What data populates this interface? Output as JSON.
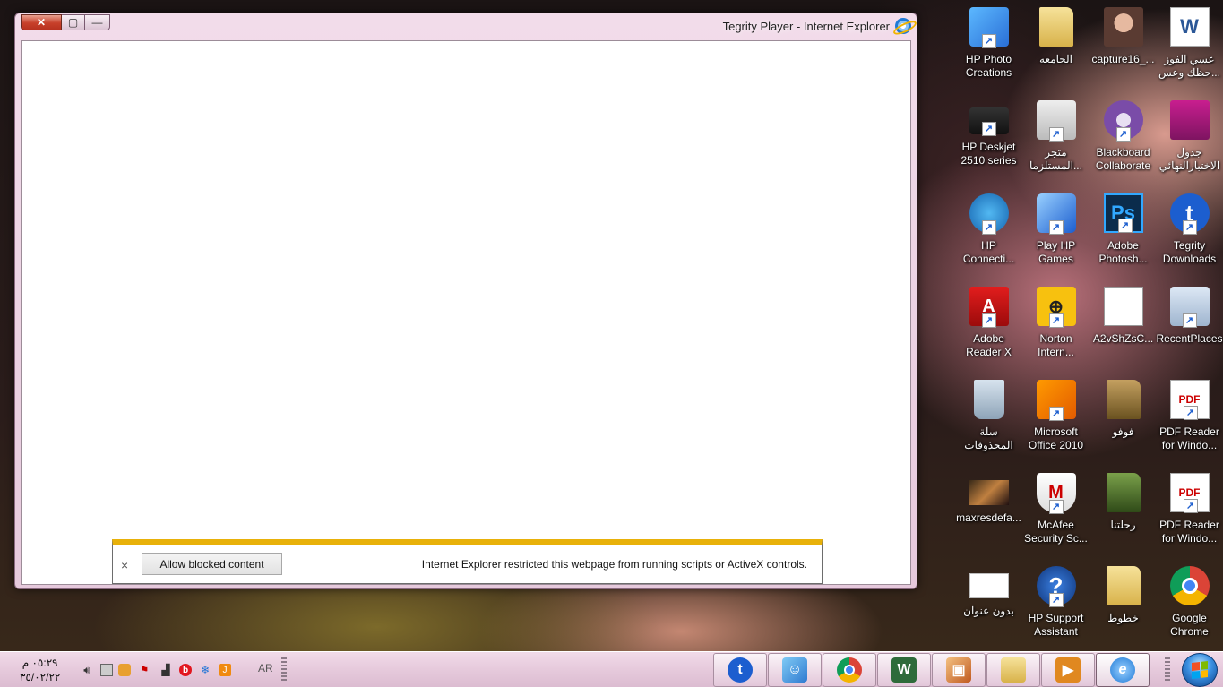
{
  "window": {
    "title": "Tegrity Player - Internet Explorer",
    "close_glyph": "✕",
    "maximize_glyph": "▢",
    "minimize_glyph": "—"
  },
  "notification": {
    "close_glyph": "×",
    "button_label": "Allow blocked content",
    "message": "Internet Explorer restricted this webpage from running scripts or ActiveX controls."
  },
  "desktop_icons": [
    {
      "label": "HP Photo\nCreations",
      "icon": "hp-photo-creations-icon"
    },
    {
      "label": "الجامعه",
      "icon": "folder-icon"
    },
    {
      "label": "capture16_...",
      "icon": "photo-thumbnail-icon"
    },
    {
      "label": "عسي الفوز\nحظك وعس...",
      "icon": "word-document-icon"
    },
    {
      "label": "HP Deskjet\n2510 series",
      "icon": "printer-icon"
    },
    {
      "label": "متجر\nالمستلزما...",
      "icon": "printer-supplies-icon"
    },
    {
      "label": "Blackboard\nCollaborate",
      "icon": "blackboard-collaborate-icon"
    },
    {
      "label": "جدول\nالاختبارالنهائي",
      "icon": "onenote-document-icon"
    },
    {
      "label": "HP\nConnecti...",
      "icon": "hp-connected-icon"
    },
    {
      "label": "Play HP\nGames",
      "icon": "hp-games-icon"
    },
    {
      "label": "Adobe\nPhotosh...",
      "icon": "photoshop-icon"
    },
    {
      "label": "Tegrity\nDownloads",
      "icon": "tegrity-icon"
    },
    {
      "label": "Adobe\nReader X",
      "icon": "adobe-reader-icon"
    },
    {
      "label": "Norton\nIntern...",
      "icon": "norton-icon"
    },
    {
      "label": "A2vShZsC...",
      "icon": "image-file-icon"
    },
    {
      "label": "RecentPlaces",
      "icon": "recent-places-icon"
    },
    {
      "label": "سلة المحذوفات",
      "icon": "recycle-bin-icon"
    },
    {
      "label": "Microsoft\nOffice 2010",
      "icon": "office-icon"
    },
    {
      "label": "فوفو",
      "icon": "folder-icon"
    },
    {
      "label": "PDF Reader\nfor Windo...",
      "icon": "pdf-reader-icon"
    },
    {
      "label": "maxresdefa...",
      "icon": "image-thumbnail-icon"
    },
    {
      "label": "McAfee\nSecurity Sc...",
      "icon": "mcafee-icon"
    },
    {
      "label": "رحلتنا",
      "icon": "folder-icon"
    },
    {
      "label": "PDF Reader\nfor Windo...",
      "icon": "pdf-reader-icon"
    },
    {
      "label": "بدون عنوان",
      "icon": "blank-image-icon"
    },
    {
      "label": "HP Support\nAssistant",
      "icon": "hp-support-icon"
    },
    {
      "label": "خطوط",
      "icon": "folder-icon"
    },
    {
      "label": "Google\nChrome",
      "icon": "chrome-icon"
    }
  ],
  "taskbar": {
    "time": "٠٥:٢٩ م",
    "date": "٣٥/٠٢/٢٢",
    "language": "AR",
    "tray_icons": [
      "volume-icon",
      "network-icon",
      "update-icon",
      "flag-alert-icon",
      "signal-icon",
      "beats-audio-icon",
      "snowflake-icon",
      "java-icon"
    ],
    "pinned": [
      {
        "name": "tegrity-icon",
        "glyph": "t",
        "color": "#1c5ecf"
      },
      {
        "name": "users-icon",
        "glyph": "👥",
        "color": "#4aa0e0"
      },
      {
        "name": "chrome-icon",
        "glyph": "",
        "color": "#db4437"
      },
      {
        "name": "wordpad-icon",
        "glyph": "W",
        "color": "#2e6b3a"
      },
      {
        "name": "photo-viewer-icon",
        "glyph": "▣",
        "color": "#d06030"
      },
      {
        "name": "explorer-folder-icon",
        "glyph": "▭",
        "color": "#e0b848"
      },
      {
        "name": "media-player-icon",
        "glyph": "▶",
        "color": "#e08820"
      },
      {
        "name": "internet-explorer-icon",
        "glyph": "e",
        "color": "#1f7ad6"
      }
    ]
  }
}
